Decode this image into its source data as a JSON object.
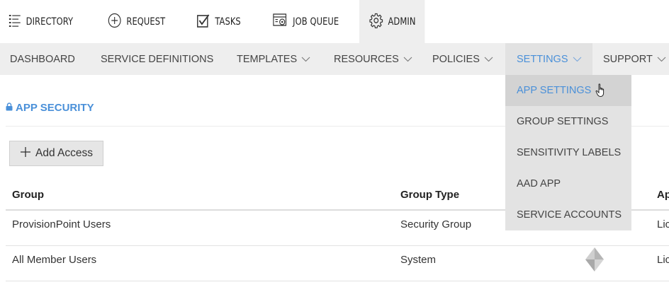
{
  "top_nav": [
    {
      "label": "DIRECTORY",
      "icon": "list-icon"
    },
    {
      "label": "REQUEST",
      "icon": "plus-circle-icon"
    },
    {
      "label": "TASKS",
      "icon": "checkbox-icon"
    },
    {
      "label": "JOB QUEUE",
      "icon": "job-queue-icon"
    },
    {
      "label": "ADMIN",
      "icon": "gear-icon"
    }
  ],
  "sub_nav": [
    {
      "label": "DASHBOARD"
    },
    {
      "label": "SERVICE DEFINITIONS"
    },
    {
      "label": "TEMPLATES"
    },
    {
      "label": "RESOURCES"
    },
    {
      "label": "POLICIES"
    },
    {
      "label": "SETTINGS"
    },
    {
      "label": "SUPPORT"
    }
  ],
  "settings_menu": [
    {
      "label": "APP SETTINGS"
    },
    {
      "label": "GROUP SETTINGS"
    },
    {
      "label": "SENSITIVITY LABELS"
    },
    {
      "label": "AAD APP"
    },
    {
      "label": "SERVICE ACCOUNTS"
    }
  ],
  "section": {
    "title": "APP SECURITY"
  },
  "add_button": {
    "label": "Add Access"
  },
  "table": {
    "columns": [
      "Group",
      "Group Type",
      "Ap"
    ],
    "rows": [
      [
        "ProvisionPoint Users",
        "Security Group",
        "Lic"
      ],
      [
        "All Member Users",
        "System",
        "Lic"
      ]
    ]
  },
  "colors": {
    "accent": "#4a90d9",
    "nav_bg": "#eeeeee",
    "dropdown_bg": "#e3e3e3"
  }
}
